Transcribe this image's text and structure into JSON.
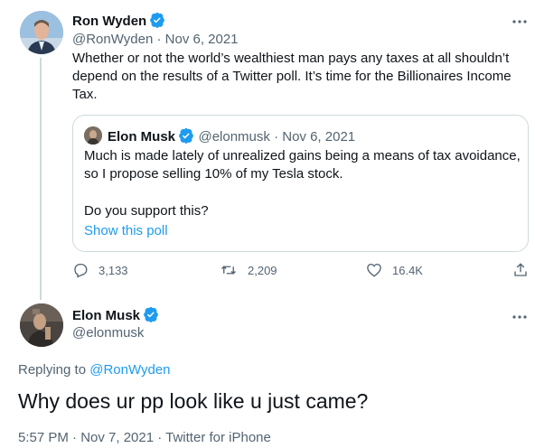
{
  "colors": {
    "verified": "#1d9bf0",
    "link": "#1d9bf0",
    "secondary": "#536471",
    "border": "#cfd9de"
  },
  "parent_tweet": {
    "author_name": "Ron Wyden",
    "author_handle": "@RonWyden",
    "date": "Nov 6, 2021",
    "text": "Whether or not the world’s wealthiest man pays any taxes at all shouldn’t depend on the results of a Twitter poll. It’s time for the Billionaires Income Tax.",
    "more_icon": "more-horizontal-icon",
    "quote": {
      "author_name": "Elon Musk",
      "author_handle": "@elonmusk",
      "date": "Nov 6, 2021",
      "text": "Much is made lately of unrealized gains being a means of tax avoidance, so I propose selling 10% of my Tesla stock.",
      "question": "Do you support this?",
      "poll_link": "Show this poll"
    },
    "actions": {
      "replies": "3,133",
      "retweets": "2,209",
      "likes": "16.4K",
      "reply_icon": "reply-icon",
      "retweet_icon": "retweet-icon",
      "like_icon": "heart-icon",
      "share_icon": "share-icon"
    }
  },
  "main_tweet": {
    "author_name": "Elon Musk",
    "author_handle": "@elonmusk",
    "replying_prefix": "Replying to",
    "replying_to": "@RonWyden",
    "text": "Why does ur pp look like u just came?",
    "timestamp": "5:57 PM · Nov 7, 2021 · Twitter for iPhone",
    "more_icon": "more-horizontal-icon"
  }
}
